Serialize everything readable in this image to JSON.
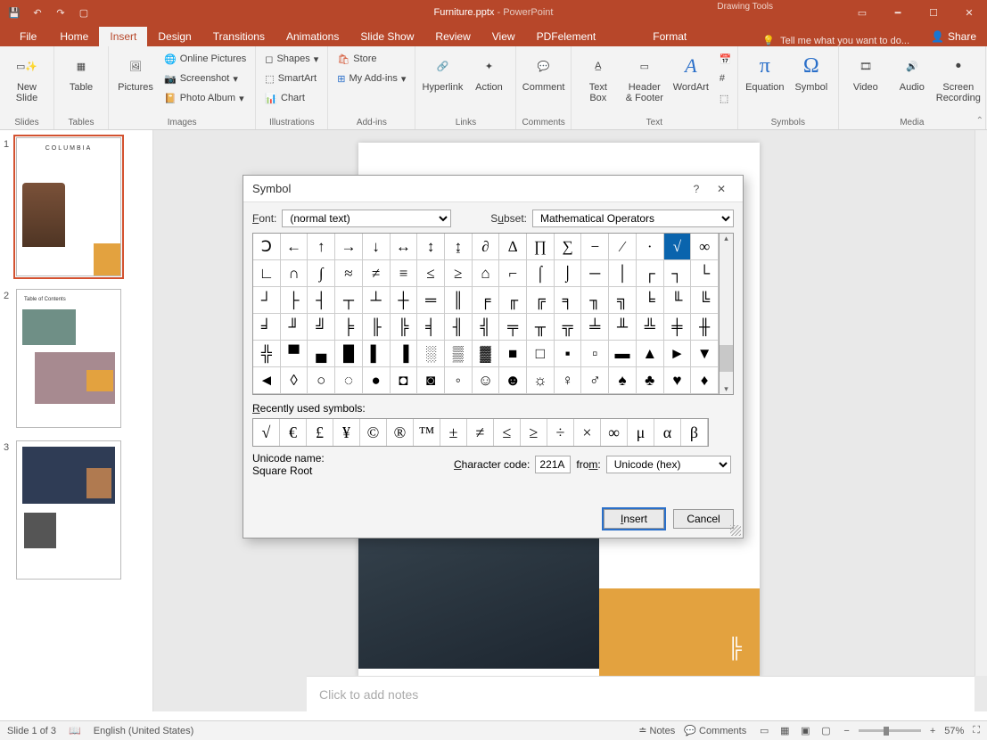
{
  "titlebar": {
    "filename": "Furniture.pptx",
    "appname": "PowerPoint",
    "context_tool": "Drawing Tools"
  },
  "tabs": {
    "file": "File",
    "items": [
      "Home",
      "Insert",
      "Design",
      "Transitions",
      "Animations",
      "Slide Show",
      "Review",
      "View",
      "PDFelement",
      "Format"
    ],
    "active": "Insert",
    "tellme": "Tell me what you want to do...",
    "share": "Share"
  },
  "ribbon": {
    "groups": {
      "slides": {
        "label": "Slides",
        "new_slide": "New\nSlide"
      },
      "tables": {
        "label": "Tables",
        "table": "Table"
      },
      "images": {
        "label": "Images",
        "pictures": "Pictures",
        "online_pictures": "Online Pictures",
        "screenshot": "Screenshot",
        "photo_album": "Photo Album"
      },
      "illustrations": {
        "label": "Illustrations",
        "shapes": "Shapes",
        "smartart": "SmartArt",
        "chart": "Chart"
      },
      "addins": {
        "label": "Add-ins",
        "store": "Store",
        "my_addins": "My Add-ins"
      },
      "links": {
        "label": "Links",
        "hyperlink": "Hyperlink",
        "action": "Action"
      },
      "comments": {
        "label": "Comments",
        "comment": "Comment"
      },
      "text": {
        "label": "Text",
        "text_box": "Text\nBox",
        "header_footer": "Header\n& Footer",
        "wordart": "WordArt"
      },
      "symbols": {
        "label": "Symbols",
        "equation": "Equation",
        "symbol": "Symbol"
      },
      "media": {
        "label": "Media",
        "video": "Video",
        "audio": "Audio",
        "screen_recording": "Screen\nRecording"
      }
    }
  },
  "slides": [
    {
      "n": "1",
      "title": "COLUMBIA"
    },
    {
      "n": "2",
      "title": "Table of Contents"
    },
    {
      "n": "3",
      "title": ""
    }
  ],
  "notes_placeholder": "Click to add notes",
  "dialog": {
    "title": "Symbol",
    "font_label": "Font:",
    "font_value": "(normal text)",
    "subset_label": "Subset:",
    "subset_value": "Mathematical Operators",
    "recent_label": "Recently used symbols:",
    "unicode_name_label": "Unicode name:",
    "unicode_name_value": "Square Root",
    "char_code_label": "Character code:",
    "char_code_value": "221A",
    "from_label": "from:",
    "from_value": "Unicode (hex)",
    "insert_btn": "Insert",
    "cancel_btn": "Cancel",
    "selected_index": 15,
    "grid": [
      "Ↄ",
      "←",
      "↑",
      "→",
      "↓",
      "↔",
      "↕",
      "↨",
      "∂",
      "∆",
      "∏",
      "∑",
      "−",
      "∕",
      "∙",
      "√",
      "∞",
      "∟",
      "∩",
      "∫",
      "≈",
      "≠",
      "≡",
      "≤",
      "≥",
      "⌂",
      "⌐",
      "⌠",
      "⌡",
      "─",
      "│",
      "┌",
      "┐",
      "└",
      "┘",
      "├",
      "┤",
      "┬",
      "┴",
      "┼",
      "═",
      "║",
      "╒",
      "╓",
      "╔",
      "╕",
      "╖",
      "╗",
      "╘",
      "╙",
      "╚",
      "╛",
      "╜",
      "╝",
      "╞",
      "╟",
      "╠",
      "╡",
      "╢",
      "╣",
      "╤",
      "╥",
      "╦",
      "╧",
      "╨",
      "╩",
      "╪",
      "╫",
      "╬",
      "▀",
      "▄",
      "█",
      "▌",
      "▐",
      "░",
      "▒",
      "▓",
      "■",
      "□",
      "▪",
      "▫",
      "▬",
      "▲",
      "►",
      "▼",
      "◄",
      "◊",
      "○",
      "◌",
      "●",
      "◘",
      "◙",
      "◦",
      "☺",
      "☻",
      "☼",
      "♀",
      "♂",
      "♠",
      "♣",
      "♥",
      "♦"
    ],
    "recent": [
      "√",
      "€",
      "£",
      "¥",
      "©",
      "®",
      "™",
      "±",
      "≠",
      "≤",
      "≥",
      "÷",
      "×",
      "∞",
      "μ",
      "α",
      "β"
    ]
  },
  "statusbar": {
    "slide_pos": "Slide 1 of 3",
    "lang": "English (United States)",
    "notes": "Notes",
    "comments": "Comments",
    "zoom_pct": "57%"
  }
}
